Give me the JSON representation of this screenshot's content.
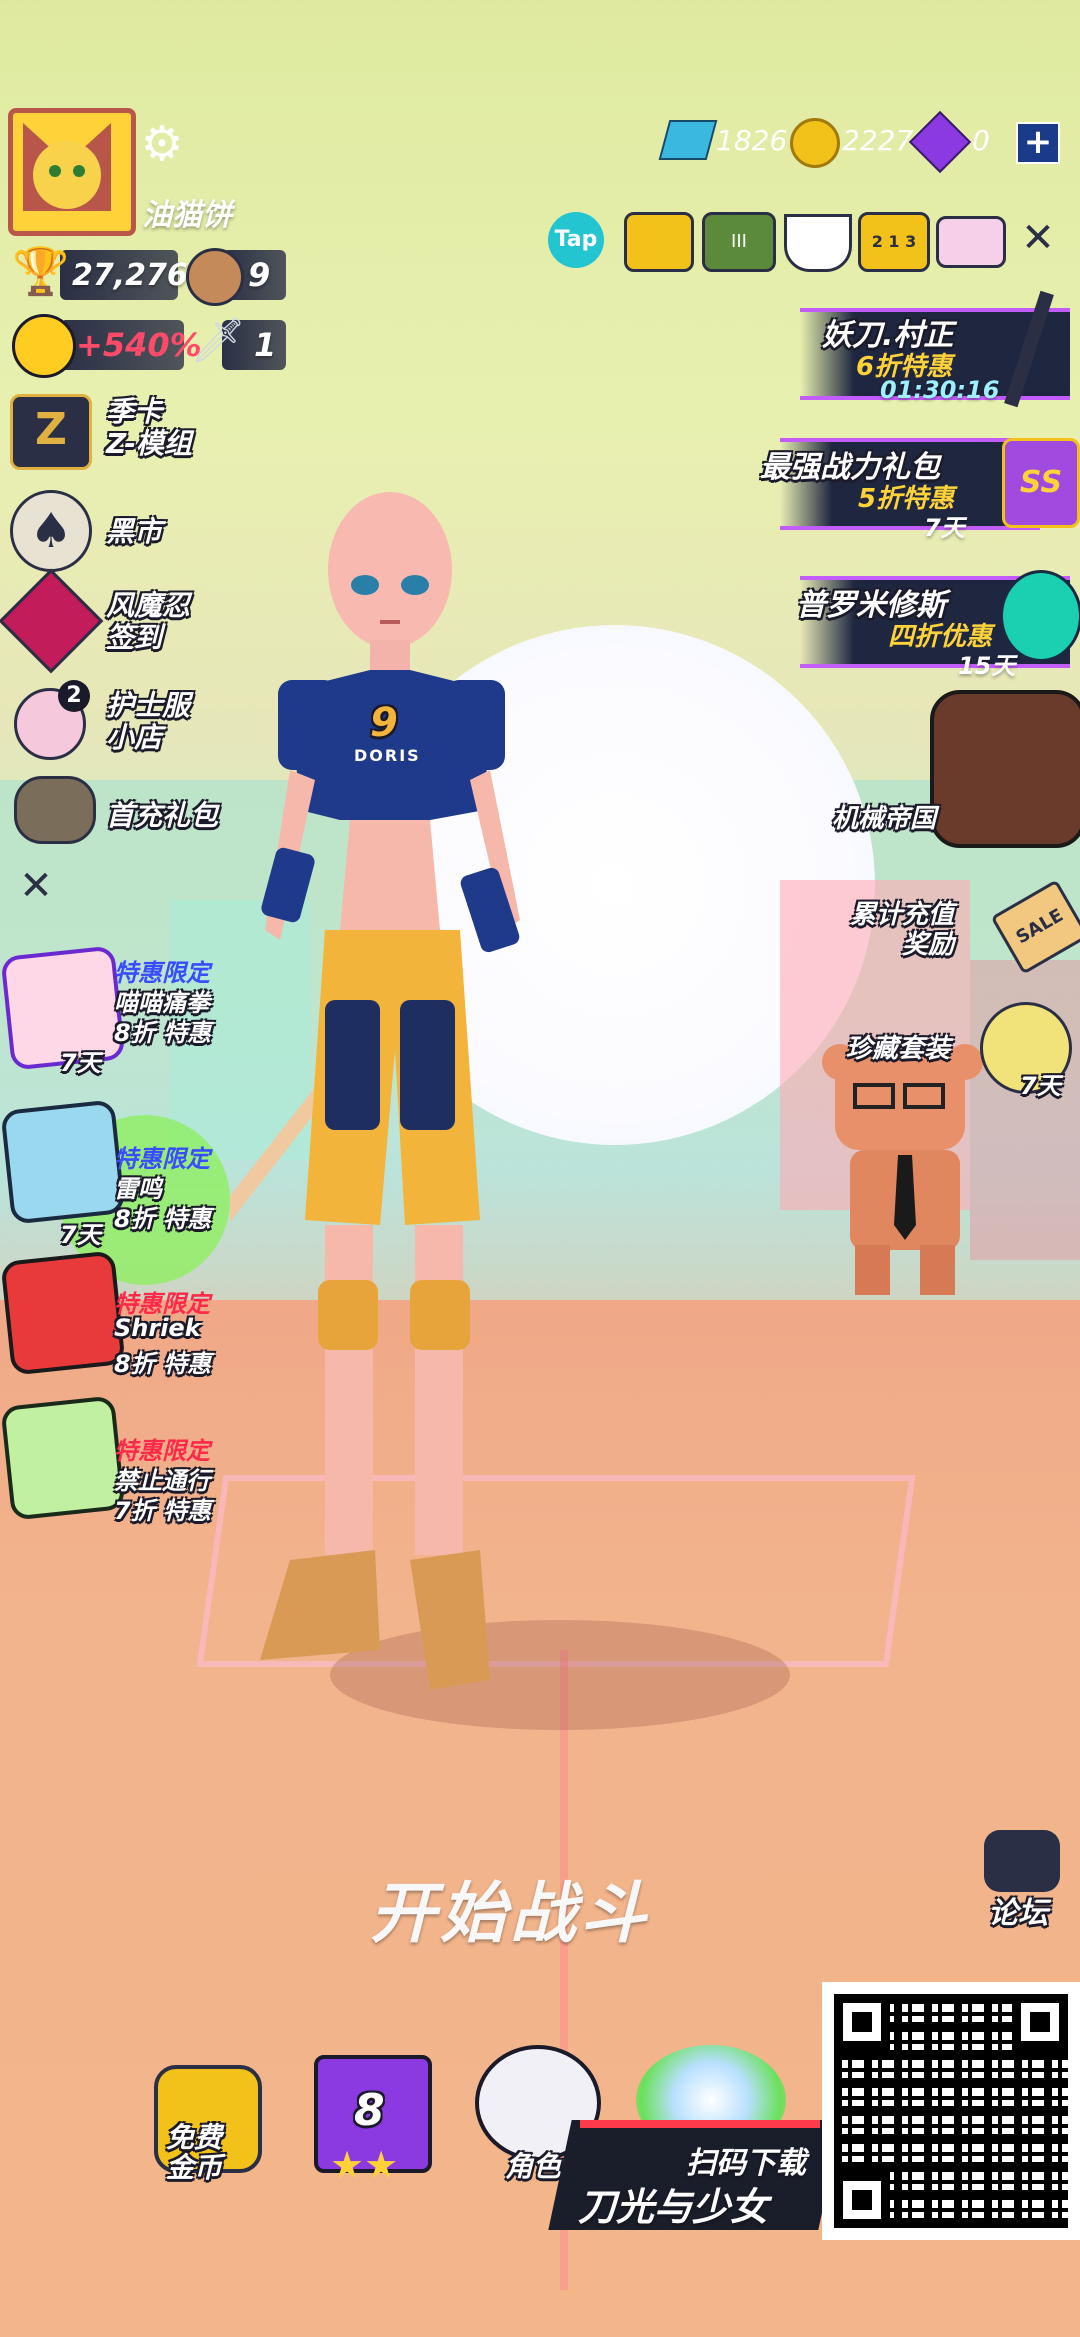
{
  "profile": {
    "name": "油猫饼",
    "trophies": "27,276",
    "pets": "9",
    "boost": "+540%",
    "swords": "1"
  },
  "currency": {
    "gems": "1826",
    "coins": "2227",
    "crystals": "0"
  },
  "top_icons": [
    {
      "name": "tap-icon",
      "label": "Tap"
    },
    {
      "name": "video-icon",
      "label": ""
    },
    {
      "name": "badge-icon",
      "label": "III"
    },
    {
      "name": "cup-icon",
      "label": ""
    },
    {
      "name": "podium-icon",
      "label": "2 1 3"
    },
    {
      "name": "mail-icon",
      "label": ""
    }
  ],
  "left_menu": [
    {
      "label": "季卡\nZ-模组",
      "icon": "z-card-icon"
    },
    {
      "label": "黑市",
      "icon": "spade-icon"
    },
    {
      "label": "风魔忍\n签到",
      "icon": "shuriken-icon"
    },
    {
      "label": "护士服\n小店",
      "icon": "nurse-icon",
      "badge": "2"
    },
    {
      "label": "首充礼包",
      "icon": "gift-pig-icon"
    }
  ],
  "left_offers": [
    {
      "title": "特惠限定",
      "name": "喵喵痛拳",
      "discount": "8折 特惠",
      "days": "7天",
      "color": "#ff2a4a"
    },
    {
      "title": "特惠限定",
      "name": "雷鸣",
      "discount": "8折 特惠",
      "days": "7天",
      "color": "#ff2a4a"
    },
    {
      "title": "特惠限定",
      "name": "Shriek",
      "discount": "8折 特惠",
      "days": "",
      "color": "#ff2a4a"
    },
    {
      "title": "特惠限定",
      "name": "禁止通行",
      "discount": "7折 特惠",
      "days": "",
      "color": "#ff2a4a"
    }
  ],
  "right_events": [
    {
      "title": "妖刀.村正",
      "sub": "6折特惠",
      "time": "01:30:16"
    },
    {
      "title": "最强战力礼包",
      "sub": "5折特惠",
      "time": "7天"
    },
    {
      "title": "普罗米修斯",
      "sub": "四折优惠",
      "time": "15天"
    }
  ],
  "right_side": [
    {
      "label": "机械帝国"
    },
    {
      "label": "累计充值\n奖励",
      "icon_text": "SALE"
    },
    {
      "label": "珍藏套装",
      "days": "7天"
    }
  ],
  "character": {
    "jersey_number": "9",
    "jersey_name": "DORIS"
  },
  "bottom": {
    "start_label": "开始战斗",
    "forum_label": "论坛",
    "nav": [
      {
        "label": "免费\n金币"
      },
      {
        "label": "8"
      },
      {
        "label": "角色"
      }
    ],
    "scan_label": "扫码下载",
    "game_title": "刀光与少女"
  },
  "colors": {
    "accent_purple": "#c35cff",
    "gold": "#ffd23a",
    "dark": "#1e2640"
  }
}
